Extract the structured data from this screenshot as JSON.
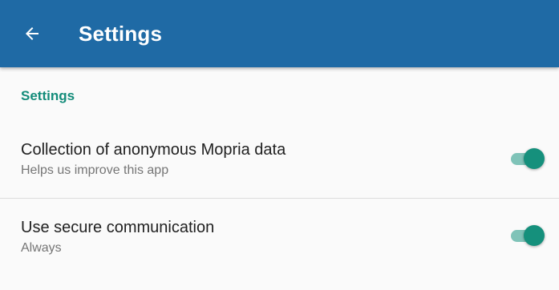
{
  "app_bar": {
    "back_icon": "arrow-left-icon",
    "title": "Settings",
    "color": "#1f6aa5"
  },
  "section": {
    "header": "Settings",
    "accent_color": "#138c7a"
  },
  "preferences": [
    {
      "title": "Collection of anonymous Mopria data",
      "summary": "Helps us improve this app",
      "enabled": true
    },
    {
      "title": "Use secure communication",
      "summary": "Always",
      "enabled": true
    }
  ]
}
